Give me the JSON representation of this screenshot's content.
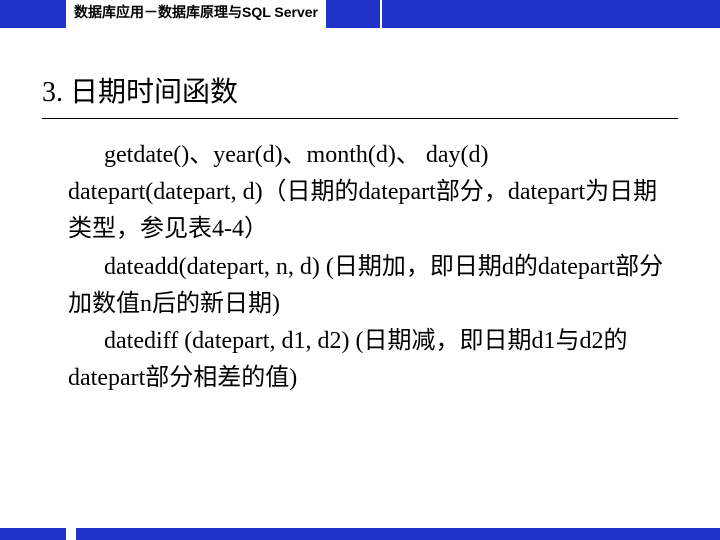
{
  "header": {
    "title": "数据库应用－数据库原理与SQL Server"
  },
  "section": {
    "number": "3.",
    "title": "日期时间函数"
  },
  "body": {
    "line1": "getdate()、year(d)、month(d)、 day(d)",
    "line2": "datepart(datepart, d)（日期的datepart部分，datepart为日期类型，参见表4-4）",
    "line3": "dateadd(datepart, n, d) (日期加，即日期d的datepart部分加数值n后的新日期)",
    "line4": "datediff (datepart, d1, d2) (日期减，即日期d1与d2的datepart部分相差的值)"
  }
}
